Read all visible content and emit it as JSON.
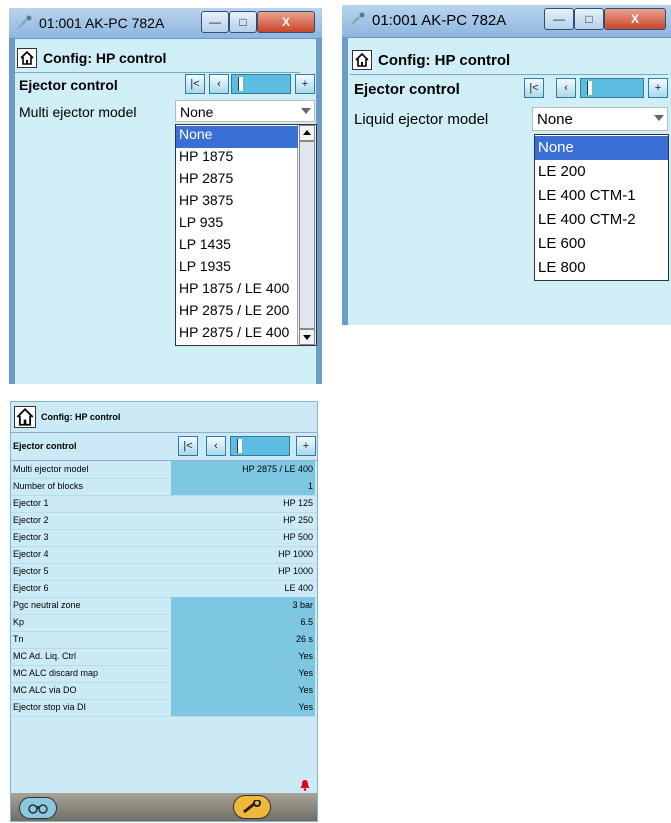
{
  "window_title": "01:001 AK-PC 782A",
  "title_buttons": {
    "minimize": "—",
    "maximize": "□",
    "close": "X"
  },
  "config_title": "Config: HP control",
  "ejector_control_label": "Ejector control",
  "nav_icons": [
    "first-icon",
    "prev-icon",
    "position-bar",
    "next-icon"
  ],
  "panel1": {
    "select_label": "Multi ejector model",
    "select_value": "None",
    "options": [
      "None",
      "HP 1875",
      "HP 2875",
      "HP 3875",
      "LP 935",
      "LP 1435",
      "LP 1935",
      "HP 1875 / LE 400",
      "HP 2875 / LE 200",
      "HP 2875 / LE 400"
    ],
    "selected_index": 0
  },
  "panel2": {
    "select_label": "Liquid ejector model",
    "select_value": "None",
    "options": [
      "None",
      "LE 200",
      "LE 400 CTM-1",
      "LE 400 CTM-2",
      "LE 600",
      "LE 800"
    ],
    "selected_index": 0
  },
  "panel3": {
    "config_title": "Config: HP control",
    "ejector_control_label": "Ejector control",
    "rows": [
      {
        "label": "Multi ejector model",
        "value": "HP 2875 / LE 400",
        "editable": true
      },
      {
        "label": "Number of blocks",
        "value": "1",
        "editable": true
      },
      {
        "label": "Ejector 1",
        "value": "HP 125",
        "editable": false
      },
      {
        "label": "Ejector 2",
        "value": "HP 250",
        "editable": false
      },
      {
        "label": "Ejector 3",
        "value": "HP 500",
        "editable": false
      },
      {
        "label": "Ejector 4",
        "value": "HP 1000",
        "editable": false
      },
      {
        "label": "Ejector 5",
        "value": "HP 1000",
        "editable": false
      },
      {
        "label": "Ejector 6",
        "value": "LE 400",
        "editable": false
      },
      {
        "label": "Pgc neutral zone",
        "value": "3 bar",
        "editable": true
      },
      {
        "label": "Kp",
        "value": "6.5",
        "editable": true
      },
      {
        "label": "Tn",
        "value": "26 s",
        "editable": true
      },
      {
        "label": "MC Ad. Liq. Ctrl",
        "value": "Yes",
        "editable": true
      },
      {
        "label": "MC ALC discard map",
        "value": "Yes",
        "editable": true
      },
      {
        "label": "MC ALC via DO",
        "value": "Yes",
        "editable": true
      },
      {
        "label": "Ejector stop via DI",
        "value": "Yes",
        "editable": true
      }
    ],
    "footer_icons": [
      "binoculars-icon",
      "wrench-icon",
      "alarm-bell-icon"
    ]
  },
  "colors": {
    "panel_bg": "#cfeef6",
    "selected": "#3a6fd6",
    "value_bg": "#7ec7e2",
    "alarm": "#e0001a"
  }
}
